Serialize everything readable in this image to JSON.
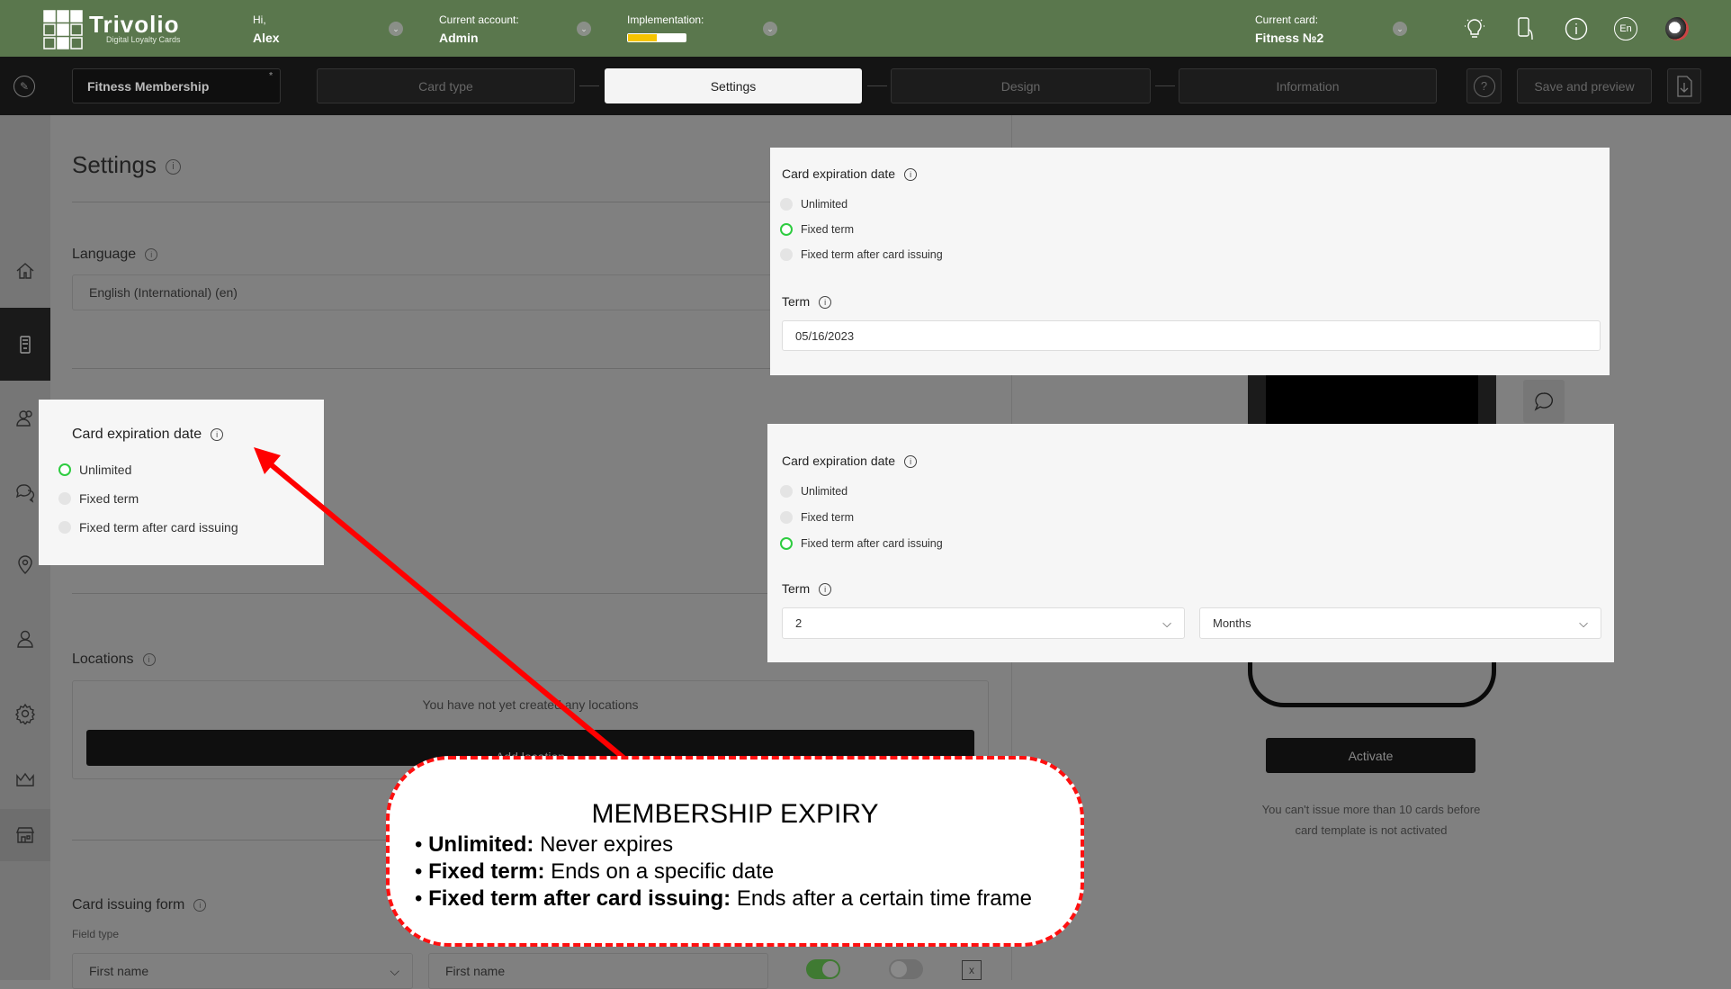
{
  "header": {
    "logo_name": "Trivolio",
    "logo_tagline": "Digital Loyalty Cards",
    "greeting": "Hi,",
    "user": "Alex",
    "account_label": "Current account:",
    "account": "Admin",
    "implementation_label": "Implementation:",
    "implementation_progress_percent": 50,
    "card_label": "Current card:",
    "card": "Fitness №2",
    "lang": "En",
    "icons": [
      "lightbulb-icon",
      "phone-icon",
      "info-icon",
      "language-icon",
      "avatar"
    ]
  },
  "toolbar": {
    "card_name": "Fitness Membership",
    "required_mark": "*",
    "steps": [
      "Card type",
      "Settings",
      "Design",
      "Information"
    ],
    "active_step": "Settings",
    "help": "?",
    "save": "Save and preview"
  },
  "sidebar": {
    "items": [
      "home-icon",
      "card-icon",
      "users-icon",
      "chat-icon",
      "location-icon",
      "user-icon",
      "gear-icon",
      "crown-icon",
      "store-icon"
    ],
    "active": "card-icon"
  },
  "main": {
    "title": "Settings",
    "language": {
      "label": "Language",
      "value": "English (International) (en)"
    },
    "expiration": {
      "label": "Card expiration date",
      "options": [
        "Unlimited",
        "Fixed term",
        "Fixed term after card issuing"
      ],
      "selected": "Unlimited"
    },
    "locations": {
      "label": "Locations",
      "empty": "You have not yet created any locations",
      "add": "Add location"
    },
    "issuing": {
      "label": "Card issuing form",
      "field_type": "Field type",
      "select_value": "First name",
      "input_value": "First name",
      "remove": "x"
    }
  },
  "popup_fixed": {
    "label": "Card expiration date",
    "options": [
      "Unlimited",
      "Fixed term",
      "Fixed term after card issuing"
    ],
    "selected": "Fixed term",
    "term_label": "Term",
    "term_value": "05/16/2023"
  },
  "popup_after": {
    "label": "Card expiration date",
    "options": [
      "Unlimited",
      "Fixed term",
      "Fixed term after card issuing"
    ],
    "selected": "Fixed term after card issuing",
    "term_label": "Term",
    "term_amount": "2",
    "term_unit": "Months"
  },
  "preview": {
    "activate": "Activate",
    "note_line1": "You can't issue more than 10 cards before",
    "note_line2": "card template is not activated"
  },
  "callout": {
    "title": "MEMBERSHIP EXPIRY",
    "items": [
      {
        "term": "Unlimited:",
        "desc": " Never expires"
      },
      {
        "term": "Fixed term:",
        "desc": "Ends on a specific date"
      },
      {
        "term": "Fixed term after card issuing:",
        "desc": "Ends after a certain time frame"
      }
    ]
  },
  "colors": {
    "header": "#5a774d",
    "toolbar": "#141414",
    "selected_radio": "#2ecc40",
    "callout_border": "#ff0000",
    "progress": "#f5c400"
  }
}
